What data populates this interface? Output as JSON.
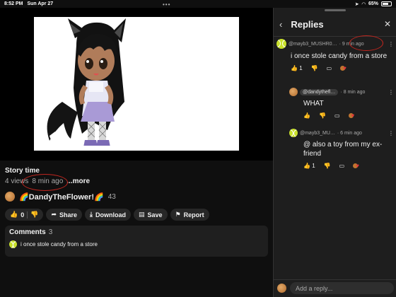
{
  "status_bar": {
    "time": "8:52 PM",
    "date": "Sun Apr 27",
    "battery": "65%",
    "wifi_icon": "wifi-icon",
    "location_icon": "location-icon"
  },
  "video": {
    "title": "Story time",
    "views": "4 views",
    "age": "8 min ago",
    "more_label": "...more",
    "channel_name": "🌈DandyTheFlower!🌈",
    "subscriber_count": "43",
    "like_count": "0",
    "share_label": "Share",
    "download_label": "Download",
    "save_label": "Save",
    "report_label": "Report"
  },
  "comments_card": {
    "label": "Comments",
    "count": "3",
    "preview_text": "i once stole candy from a store"
  },
  "replies_panel": {
    "title": "Replies",
    "main_comment": {
      "author": "@mayb3_MUSHR0…",
      "age": "· 9 min ago",
      "text": "i once stole candy from a store",
      "likes": "1"
    },
    "replies": [
      {
        "author": "@dandythefl…",
        "age": "· 8 min ago",
        "text": "WHAT",
        "likes": ""
      },
      {
        "author": "@mayb3_MU…",
        "age": "· 6 min ago",
        "text": "@ also a toy from my ex-friend",
        "likes": "1"
      }
    ],
    "reply_placeholder": "Add a reply..."
  },
  "colors": {
    "background": "#0f0f0f",
    "panel": "#1e1e1e",
    "accent_red": "#c0261f",
    "pill": "#272727"
  }
}
